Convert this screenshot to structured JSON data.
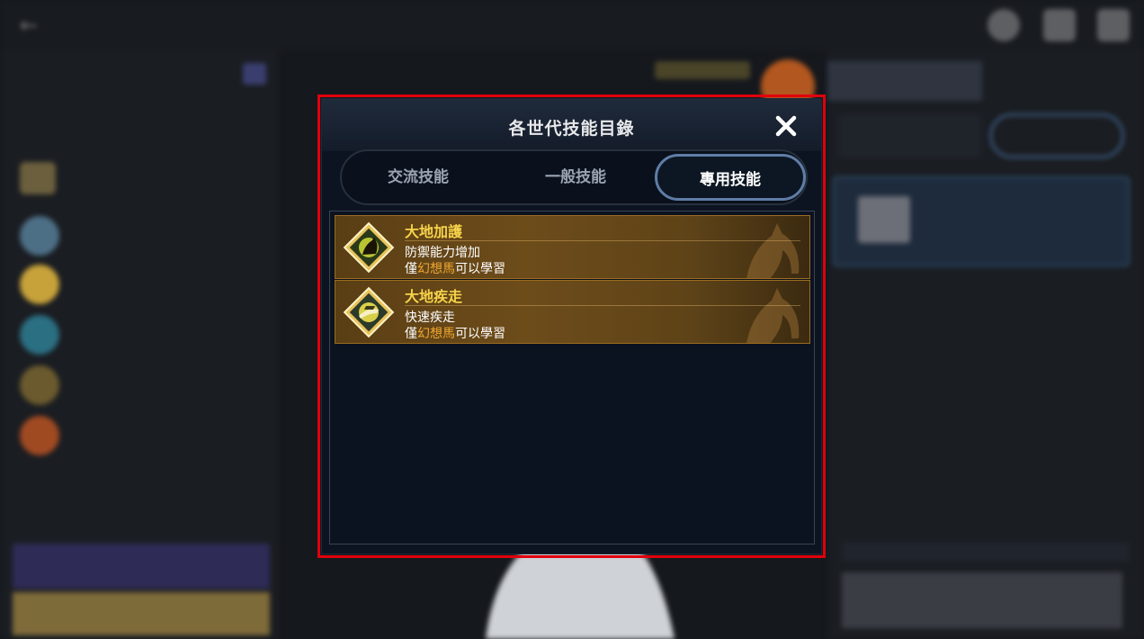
{
  "background": {
    "header_title": "",
    "back_icon": "back-arrow-icon"
  },
  "dialog": {
    "title": "各世代技能目錄",
    "close_icon": "close-icon",
    "tabs": [
      {
        "label": "交流技能",
        "selected": false
      },
      {
        "label": "一般技能",
        "selected": false
      },
      {
        "label": "專用技能",
        "selected": true
      }
    ],
    "skills": [
      {
        "name": "大地加護",
        "description": "防禦能力增加",
        "req_prefix": "僅",
        "req_highlight": "幻想馬",
        "req_suffix": "可以學習",
        "icon": "horse-shield-skill-icon"
      },
      {
        "name": "大地疾走",
        "description": "快速疾走",
        "req_prefix": "僅",
        "req_highlight": "幻想馬",
        "req_suffix": "可以學習",
        "icon": "horse-sprint-skill-icon"
      }
    ]
  },
  "colors": {
    "highlight_frame": "#e0000c",
    "skill_name": "#f6d34a",
    "requirement_highlight": "#f0a830",
    "tab_selected_border": "#5f7da6"
  }
}
